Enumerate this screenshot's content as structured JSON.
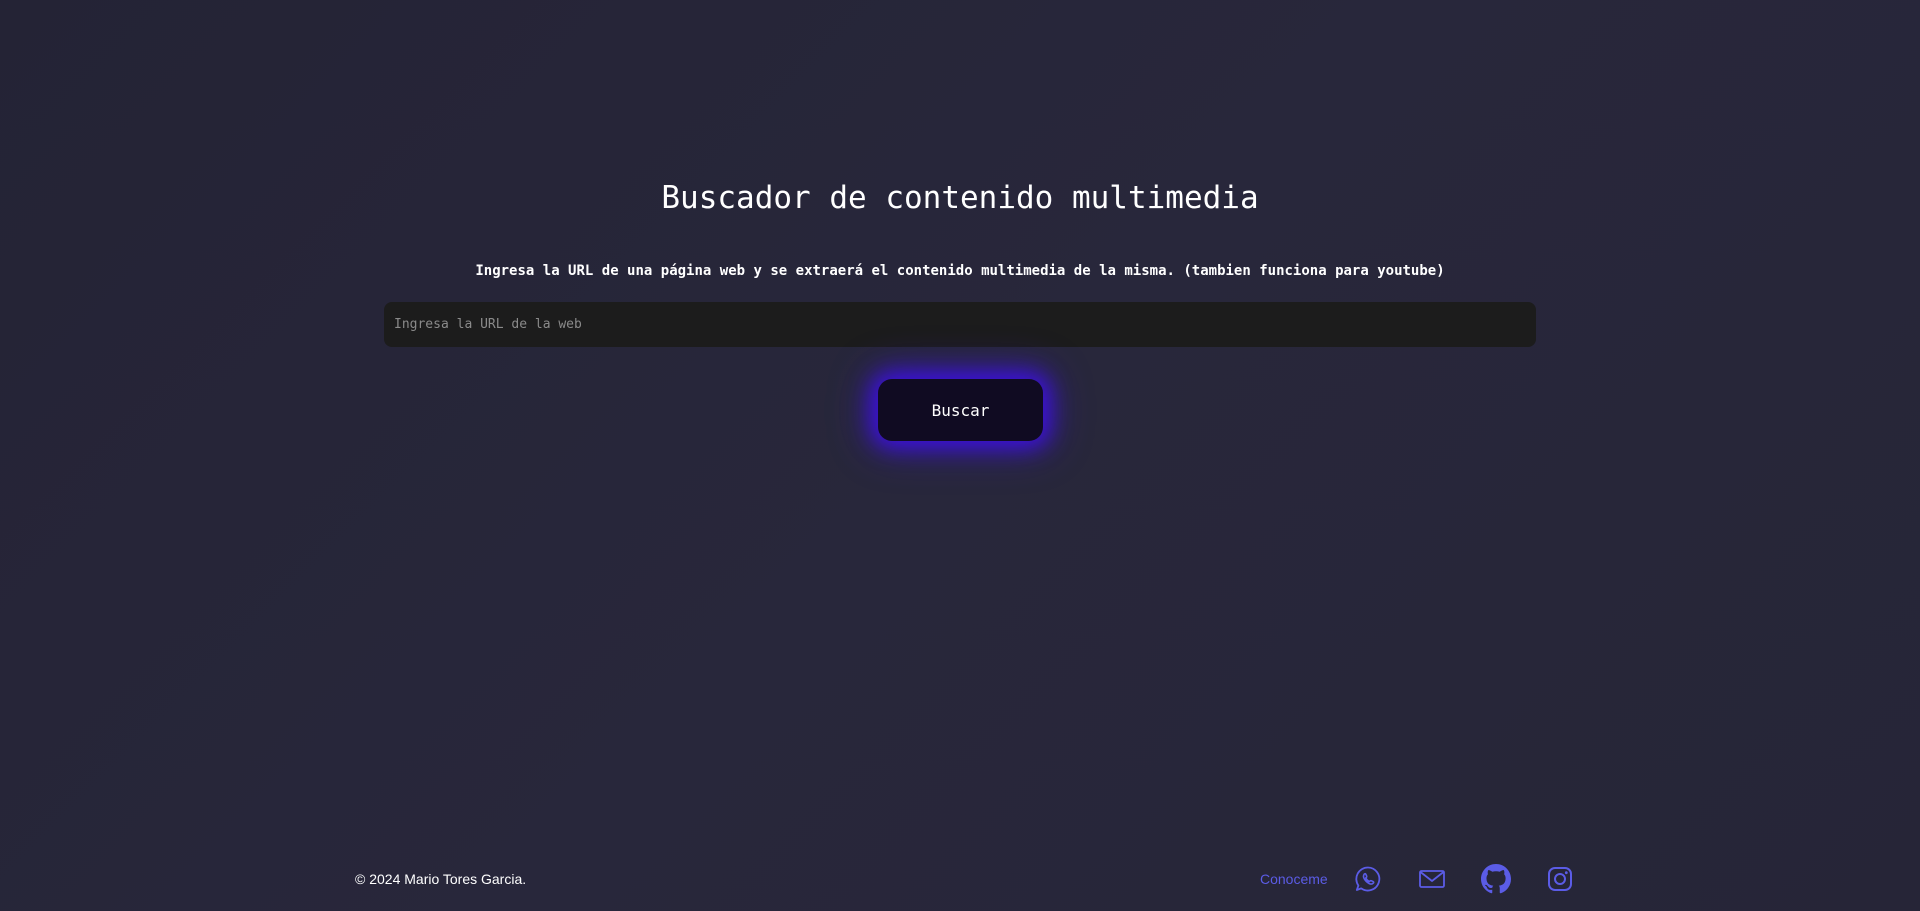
{
  "main": {
    "title": "Buscador de contenido multimedia",
    "subtitle": "Ingresa la URL de una página web y se extraerá el contenido multimedia de la misma. (tambien funciona para youtube)",
    "url_input": {
      "value": "",
      "placeholder": "Ingresa la URL de la web"
    },
    "search_button_label": "Buscar"
  },
  "footer": {
    "copyright": "© 2024 Mario Tores Garcia.",
    "conoceme_label": "Conoceme",
    "social_icons": [
      "whatsapp-icon",
      "mail-icon",
      "github-icon",
      "instagram-icon"
    ]
  },
  "colors": {
    "background": "#272638",
    "accent": "#5b5ce6",
    "button_glow": "#3d10e0",
    "input_background": "#1c1c1c"
  }
}
